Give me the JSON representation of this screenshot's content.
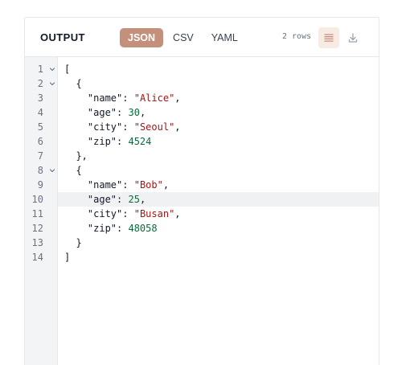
{
  "panel": {
    "title": "OUTPUT",
    "tabs": [
      {
        "label": "JSON",
        "active": true
      },
      {
        "label": "CSV",
        "active": false
      },
      {
        "label": "YAML",
        "active": false
      }
    ],
    "row_count": "2 rows",
    "wrap_icon": "wrap-lines-icon",
    "download_icon": "download-icon"
  },
  "colors": {
    "accent": "#c4907c",
    "accent_soft": "#f8ebe4",
    "string": "#a31515",
    "number": "#0b6b3a"
  },
  "editor": {
    "active_line": 10,
    "lines": [
      {
        "num": "1",
        "fold": true,
        "tokens": [
          {
            "t": "pun",
            "v": "["
          }
        ]
      },
      {
        "num": "2",
        "fold": true,
        "tokens": [
          {
            "t": "pun",
            "v": "  {"
          }
        ]
      },
      {
        "num": "3",
        "fold": false,
        "tokens": [
          {
            "t": "pun",
            "v": "    "
          },
          {
            "t": "key",
            "v": "\"name\""
          },
          {
            "t": "pun",
            "v": ": "
          },
          {
            "t": "str",
            "v": "\"Alice\""
          },
          {
            "t": "pun",
            "v": ","
          }
        ]
      },
      {
        "num": "4",
        "fold": false,
        "tokens": [
          {
            "t": "pun",
            "v": "    "
          },
          {
            "t": "key",
            "v": "\"age\""
          },
          {
            "t": "pun",
            "v": ": "
          },
          {
            "t": "num",
            "v": "30"
          },
          {
            "t": "pun",
            "v": ","
          }
        ]
      },
      {
        "num": "5",
        "fold": false,
        "tokens": [
          {
            "t": "pun",
            "v": "    "
          },
          {
            "t": "key",
            "v": "\"city\""
          },
          {
            "t": "pun",
            "v": ": "
          },
          {
            "t": "str",
            "v": "\"Seoul\""
          },
          {
            "t": "pun",
            "v": ","
          }
        ]
      },
      {
        "num": "6",
        "fold": false,
        "tokens": [
          {
            "t": "pun",
            "v": "    "
          },
          {
            "t": "key",
            "v": "\"zip\""
          },
          {
            "t": "pun",
            "v": ": "
          },
          {
            "t": "num",
            "v": "4524"
          }
        ]
      },
      {
        "num": "7",
        "fold": false,
        "tokens": [
          {
            "t": "pun",
            "v": "  },"
          }
        ]
      },
      {
        "num": "8",
        "fold": true,
        "tokens": [
          {
            "t": "pun",
            "v": "  {"
          }
        ]
      },
      {
        "num": "9",
        "fold": false,
        "tokens": [
          {
            "t": "pun",
            "v": "    "
          },
          {
            "t": "key",
            "v": "\"name\""
          },
          {
            "t": "pun",
            "v": ": "
          },
          {
            "t": "str",
            "v": "\"Bob\""
          },
          {
            "t": "pun",
            "v": ","
          }
        ]
      },
      {
        "num": "10",
        "fold": false,
        "tokens": [
          {
            "t": "pun",
            "v": "    "
          },
          {
            "t": "key",
            "v": "\"age\""
          },
          {
            "t": "pun",
            "v": ": "
          },
          {
            "t": "num",
            "v": "25"
          },
          {
            "t": "pun",
            "v": ","
          }
        ]
      },
      {
        "num": "11",
        "fold": false,
        "tokens": [
          {
            "t": "pun",
            "v": "    "
          },
          {
            "t": "key",
            "v": "\"city\""
          },
          {
            "t": "pun",
            "v": ": "
          },
          {
            "t": "str",
            "v": "\"Busan\""
          },
          {
            "t": "pun",
            "v": ","
          }
        ]
      },
      {
        "num": "12",
        "fold": false,
        "tokens": [
          {
            "t": "pun",
            "v": "    "
          },
          {
            "t": "key",
            "v": "\"zip\""
          },
          {
            "t": "pun",
            "v": ": "
          },
          {
            "t": "num",
            "v": "48058"
          }
        ]
      },
      {
        "num": "13",
        "fold": false,
        "tokens": [
          {
            "t": "pun",
            "v": "  }"
          }
        ]
      },
      {
        "num": "14",
        "fold": false,
        "tokens": [
          {
            "t": "pun",
            "v": "]"
          }
        ]
      }
    ]
  }
}
